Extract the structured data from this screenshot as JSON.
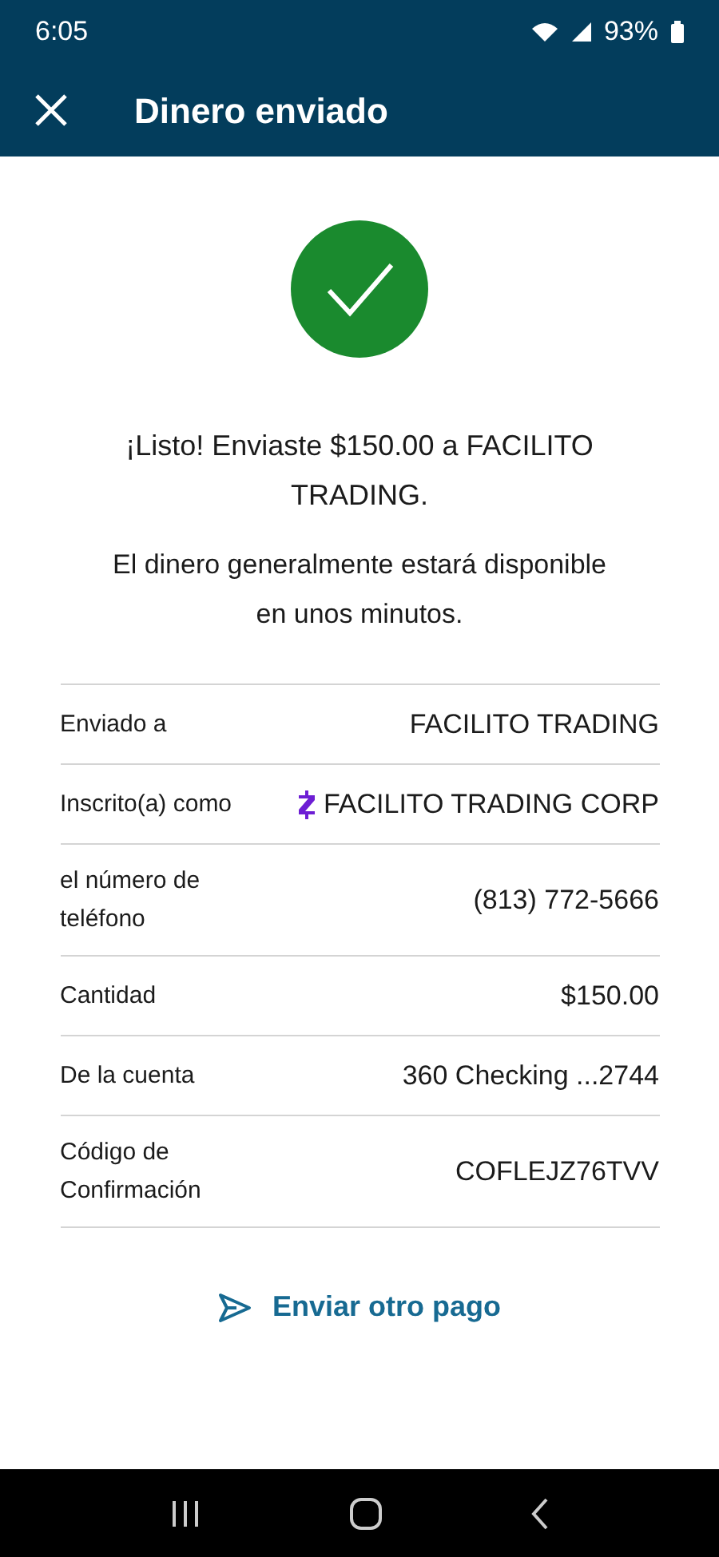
{
  "status_bar": {
    "time": "6:05",
    "battery": "93%"
  },
  "header": {
    "title": "Dinero enviado"
  },
  "message": "¡Listo! Enviaste $150.00 a FACILITO TRADING.",
  "note": "El dinero generalmente estará disponible en unos minutos.",
  "details": [
    {
      "kind": "plain",
      "label": "Enviado a",
      "value": "FACILITO TRADING"
    },
    {
      "kind": "enrolled",
      "label": "Inscrito(a) como",
      "value": "FACILITO TRADING CORP"
    },
    {
      "kind": "plain",
      "label": "el número de teléfono",
      "value": "(813) 772-5666"
    },
    {
      "kind": "plain",
      "label": "Cantidad",
      "value": "$150.00"
    },
    {
      "kind": "plain",
      "label": "De la cuenta",
      "value": "360 Checking ...2744"
    },
    {
      "kind": "plain",
      "label": "Código de Confirmación",
      "value": "COFLEJZ76TVV"
    }
  ],
  "action": "Enviar otro pago"
}
